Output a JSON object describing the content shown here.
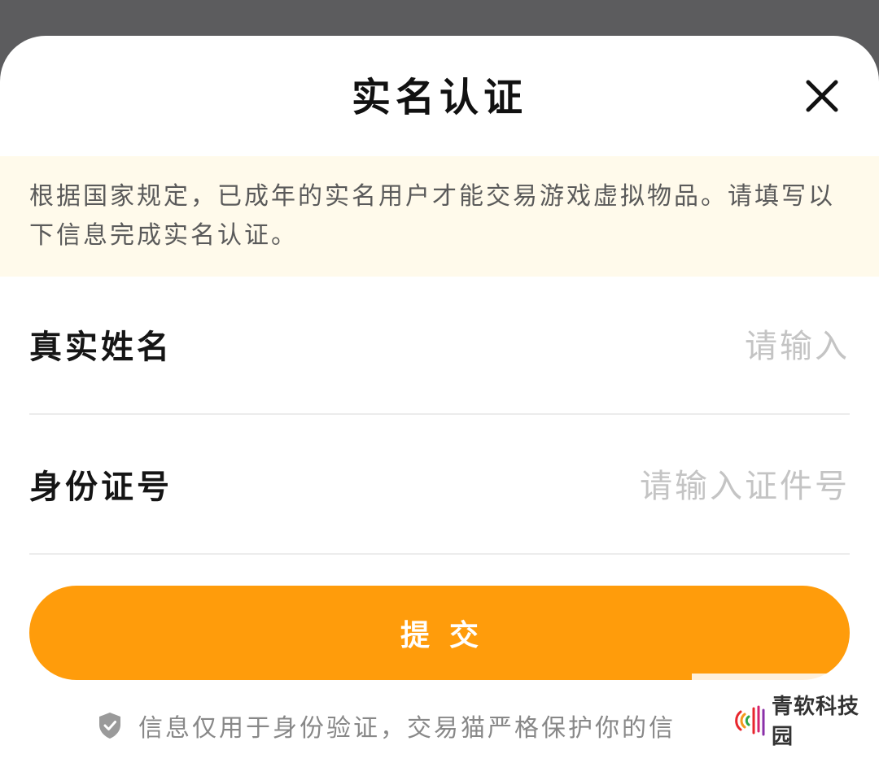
{
  "dialog": {
    "title": "实名认证",
    "notice": "根据国家规定，已成年的实名用户才能交易游戏虚拟物品。请填写以下信息完成实名认证。"
  },
  "form": {
    "name_label": "真实姓名",
    "name_placeholder": "请输入",
    "id_label": "身份证号",
    "id_placeholder": "请输入证件号",
    "submit_label": "提交"
  },
  "privacy": {
    "text": "信息仅用于身份验证，交易猫严格保护你的信"
  },
  "watermark": {
    "text": "青软科技园"
  },
  "colors": {
    "accent": "#ff9c0b",
    "notice_bg": "#fffaeb",
    "backdrop": "#5c5c5e"
  },
  "icons": {
    "close": "close-icon",
    "privacy": "shield-check-icon",
    "watermark_logo": "watermark-logo-icon"
  }
}
